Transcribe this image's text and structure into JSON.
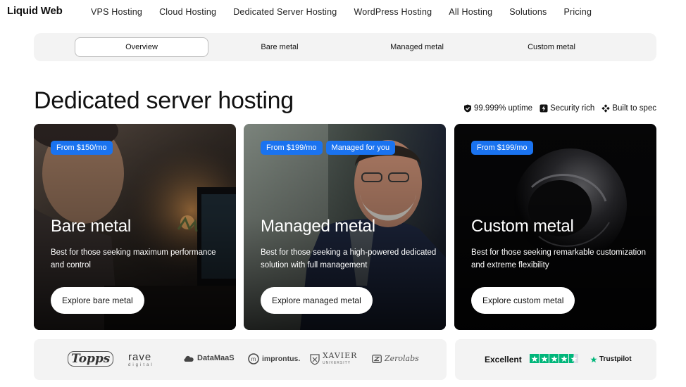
{
  "brand": {
    "name": "Liquid Web"
  },
  "nav": {
    "items": [
      {
        "label": "VPS Hosting"
      },
      {
        "label": "Cloud Hosting"
      },
      {
        "label": "Dedicated Server Hosting"
      },
      {
        "label": "WordPress Hosting"
      },
      {
        "label": "All Hosting"
      },
      {
        "label": "Solutions"
      },
      {
        "label": "Pricing"
      }
    ]
  },
  "tabs": {
    "items": [
      {
        "label": "Overview",
        "active": true
      },
      {
        "label": "Bare metal"
      },
      {
        "label": "Managed metal"
      },
      {
        "label": "Custom metal"
      }
    ]
  },
  "page": {
    "title": "Dedicated server hosting"
  },
  "features": [
    {
      "icon": "shield-check-icon",
      "label": "99.999% uptime"
    },
    {
      "icon": "lightning-icon",
      "label": "Security rich"
    },
    {
      "icon": "grid-diamond-icon",
      "label": "Built to spec"
    }
  ],
  "cards": [
    {
      "badges": [
        "From $150/mo"
      ],
      "title": "Bare metal",
      "description": "Best for those seeking maximum performance and control",
      "button": "Explore bare metal"
    },
    {
      "badges": [
        "From $199/mo",
        "Managed for you"
      ],
      "title": "Managed metal",
      "description": "Best for those seeking a high-powered dedicated solution with full management",
      "button": "Explore managed metal"
    },
    {
      "badges": [
        "From $199/mo"
      ],
      "title": "Custom metal",
      "description": "Best for those seeking remarkable customization and extreme flexibility",
      "button": "Explore custom metal"
    }
  ],
  "logos": {
    "topps": "Topps",
    "rave": "rave",
    "rave_sub": "digital",
    "datamaas": "DataMaaS",
    "improntus": "improntus.",
    "xavier": "XAVIER",
    "xavier_sub": "UNIVERSITY",
    "zerolabs": "Zerolabs"
  },
  "trust": {
    "label": "Excellent",
    "rating": 4.5,
    "stars_max": 5,
    "provider": "Trustpilot",
    "color": "#00b67a"
  },
  "colors": {
    "accent": "#1a73f0",
    "panel": "#f3f3f3"
  }
}
